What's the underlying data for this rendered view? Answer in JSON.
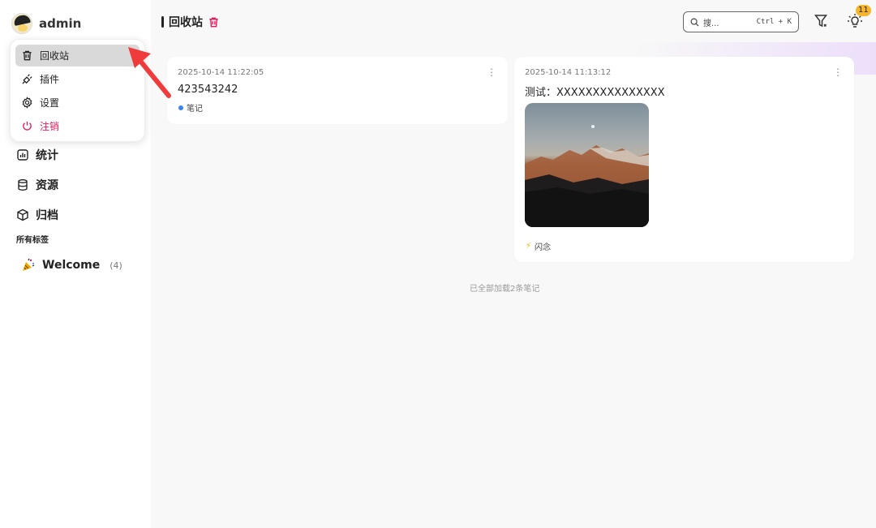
{
  "user": {
    "name": "admin"
  },
  "menu": {
    "items": [
      {
        "label": "回收站",
        "icon": "trash-icon",
        "active": true
      },
      {
        "label": "插件",
        "icon": "plug-icon"
      },
      {
        "label": "设置",
        "icon": "gear-icon"
      },
      {
        "label": "注销",
        "icon": "power-icon",
        "danger": true
      }
    ]
  },
  "nav": {
    "items": [
      {
        "label": "统计",
        "icon": "chart-icon"
      },
      {
        "label": "资源",
        "icon": "database-icon"
      },
      {
        "label": "归档",
        "icon": "box-icon"
      }
    ],
    "tags_title": "所有标签",
    "tags": [
      {
        "name": "Welcome",
        "count": "(4)",
        "icon": "party-popper-icon"
      }
    ]
  },
  "header": {
    "title": "回收站",
    "search_placeholder": "搜...",
    "search_shortcut": "Ctrl + K",
    "notification_count": "11"
  },
  "cards": [
    {
      "time": "2025-10-14 11:22:05",
      "content": "423543242",
      "tag": "笔记",
      "tag_icon": "blue-dot-icon"
    },
    {
      "time": "2025-10-14 11:13:12",
      "content": "测试：XXXXXXXXXXXXXXX",
      "tag": "闪念",
      "tag_icon": "lightning-icon"
    }
  ],
  "footer": {
    "text": "已全部加载2条笔记"
  },
  "colors": {
    "danger": "#e5195a",
    "badge": "#f7b52b",
    "arrow": "#ef3b3b",
    "active_bg": "#d9d9d9"
  }
}
